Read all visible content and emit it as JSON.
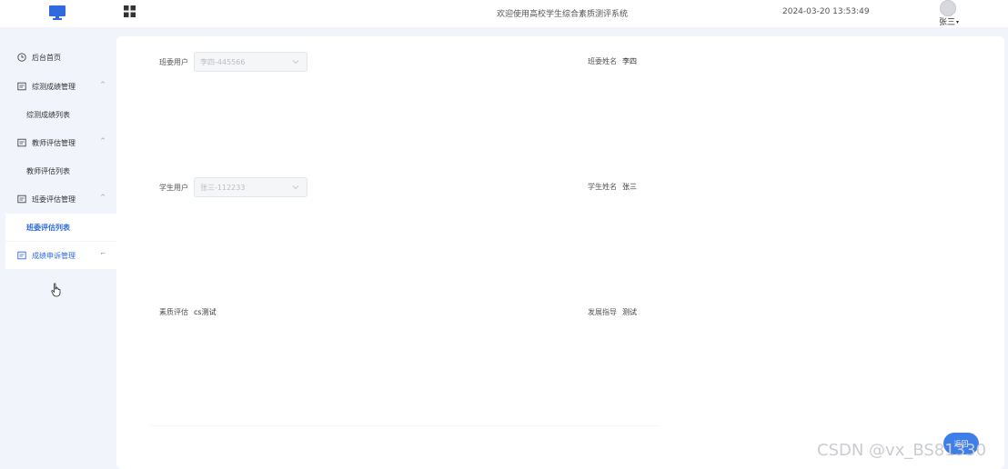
{
  "header": {
    "site_title": "欢迎使用高校学生综合素质测评系统",
    "clock": "2024-03-20 13:53:49",
    "username": "张三",
    "username_caret": "▾",
    "logo_icon": "monitor-icon",
    "grid_icon": "apps-grid-icon",
    "avatar_icon": "user-avatar"
  },
  "sidebar": {
    "items": [
      {
        "label": "后台首页",
        "icon": "clock-icon",
        "arrow": ""
      },
      {
        "label": "综测成绩管理",
        "icon": "form-icon",
        "arrow": "^"
      },
      {
        "label": "综测成绩列表",
        "icon": "",
        "arrow": ""
      },
      {
        "label": "教师评估管理",
        "icon": "form-icon",
        "arrow": "^"
      },
      {
        "label": "教师评估列表",
        "icon": "",
        "arrow": ""
      },
      {
        "label": "班委评估管理",
        "icon": "form-icon",
        "arrow": "^"
      },
      {
        "label": "班委评估列表",
        "icon": "",
        "arrow": ""
      },
      {
        "label": "成绩申诉管理",
        "icon": "form-icon",
        "arrow": "⌐"
      }
    ]
  },
  "form": {
    "class_user_label": "班委用户",
    "class_user_value": "李四-445566",
    "class_name_label": "班委姓名",
    "class_name_value": "李四",
    "student_user_label": "学生用户",
    "student_user_value": "张三-112233",
    "student_name_label": "学生姓名",
    "student_name_value": "张三",
    "quality_eval_label": "素质评估",
    "quality_eval_value": "cs测试",
    "guidance_label": "发展指导",
    "guidance_value": "测试"
  },
  "actions": {
    "back_label": "返回"
  },
  "watermark": "CSDN @vx_BS81330",
  "colors": {
    "accent": "#3d7ee8",
    "active_text": "#2f6bde",
    "background": "#f1f4fb"
  }
}
